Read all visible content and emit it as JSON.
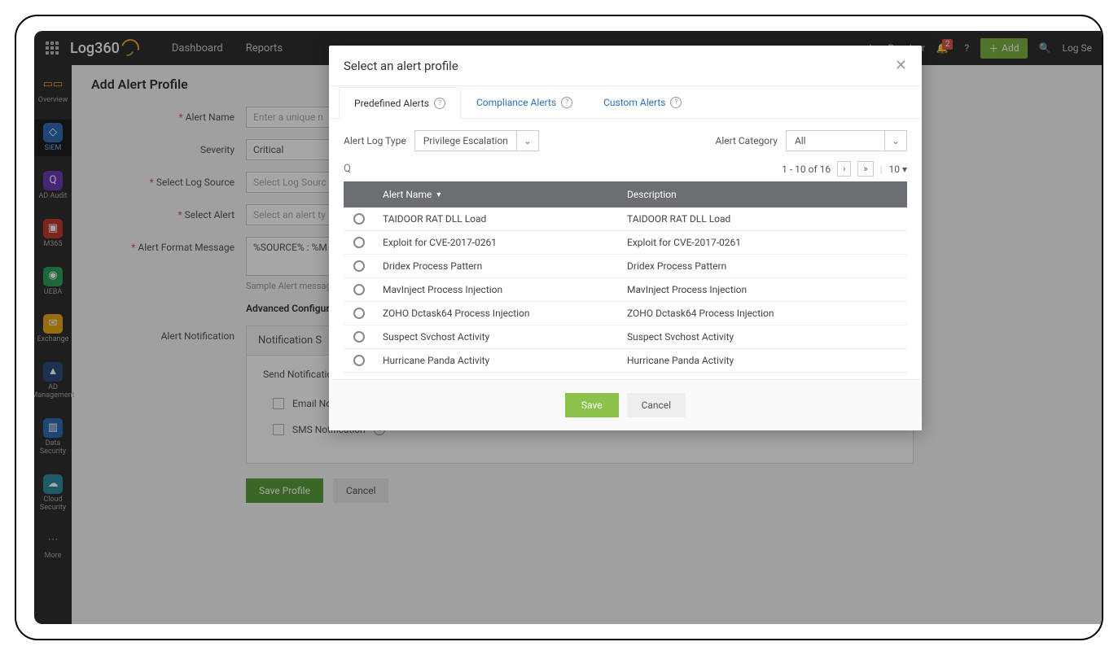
{
  "brand": "Log360",
  "topnav": {
    "dashboard": "Dashboard",
    "reports": "Reports"
  },
  "topbar": {
    "log_receiver": "Log Receiver",
    "notif_count": "2",
    "add": "Add",
    "log_search": "Log Se"
  },
  "sidebar": {
    "overview": "Overview",
    "siem": "SIEM",
    "adaudit": "AD Audit",
    "m365": "M365",
    "ueba": "UEBA",
    "exchange": "Exchange",
    "admgmt": "AD Management",
    "datasec": "Data Security",
    "cloudsec": "Cloud Security",
    "more": "More"
  },
  "page": {
    "title": "Add Alert Profile",
    "alert_name_label": "Alert Name",
    "alert_name_placeholder": "Enter a unique n",
    "severity_label": "Severity",
    "severity_value": "Critical",
    "log_source_label": "Select Log Source",
    "log_source_placeholder": "Select Log Sourc",
    "select_alert_label": "Select Alert",
    "select_alert_placeholder": "Select an alert ty",
    "format_label": "Alert Format Message",
    "format_value": "%SOURCE% : %M",
    "sample_msg": "Sample Alert message",
    "adv_config": "Advanced Configur",
    "notification_label": "Alert Notification",
    "notification_header": "Notification S",
    "send_via": "Send Notification",
    "email_notif": "Email Notification",
    "sms_notif": "SMS Notification",
    "save_profile": "Save Profile",
    "cancel": "Cancel"
  },
  "modal": {
    "title": "Select an alert profile",
    "tabs": {
      "predefined": "Predefined Alerts",
      "compliance": "Compliance Alerts",
      "custom": "Custom Alerts"
    },
    "log_type_label": "Alert Log Type",
    "log_type_value": "Privilege Escalation",
    "category_label": "Alert Category",
    "category_value": "All",
    "paging_text": "1 - 10 of 16",
    "page_size": "10",
    "col_name": "Alert Name",
    "col_desc": "Description",
    "rows": [
      {
        "name": "TAIDOOR RAT DLL Load",
        "desc": "TAIDOOR RAT DLL Load"
      },
      {
        "name": "Exploit for CVE-2017-0261",
        "desc": "Exploit for CVE-2017-0261"
      },
      {
        "name": "Dridex Process Pattern",
        "desc": "Dridex Process Pattern"
      },
      {
        "name": "MavInject Process Injection",
        "desc": "MavInject Process Injection"
      },
      {
        "name": "ZOHO Dctask64 Process Injection",
        "desc": "ZOHO Dctask64 Process Injection"
      },
      {
        "name": "Suspect Svchost Activity",
        "desc": "Suspect Svchost Activity"
      },
      {
        "name": "Hurricane Panda Activity",
        "desc": "Hurricane Panda Activity"
      }
    ],
    "save": "Save",
    "cancel": "Cancel"
  }
}
